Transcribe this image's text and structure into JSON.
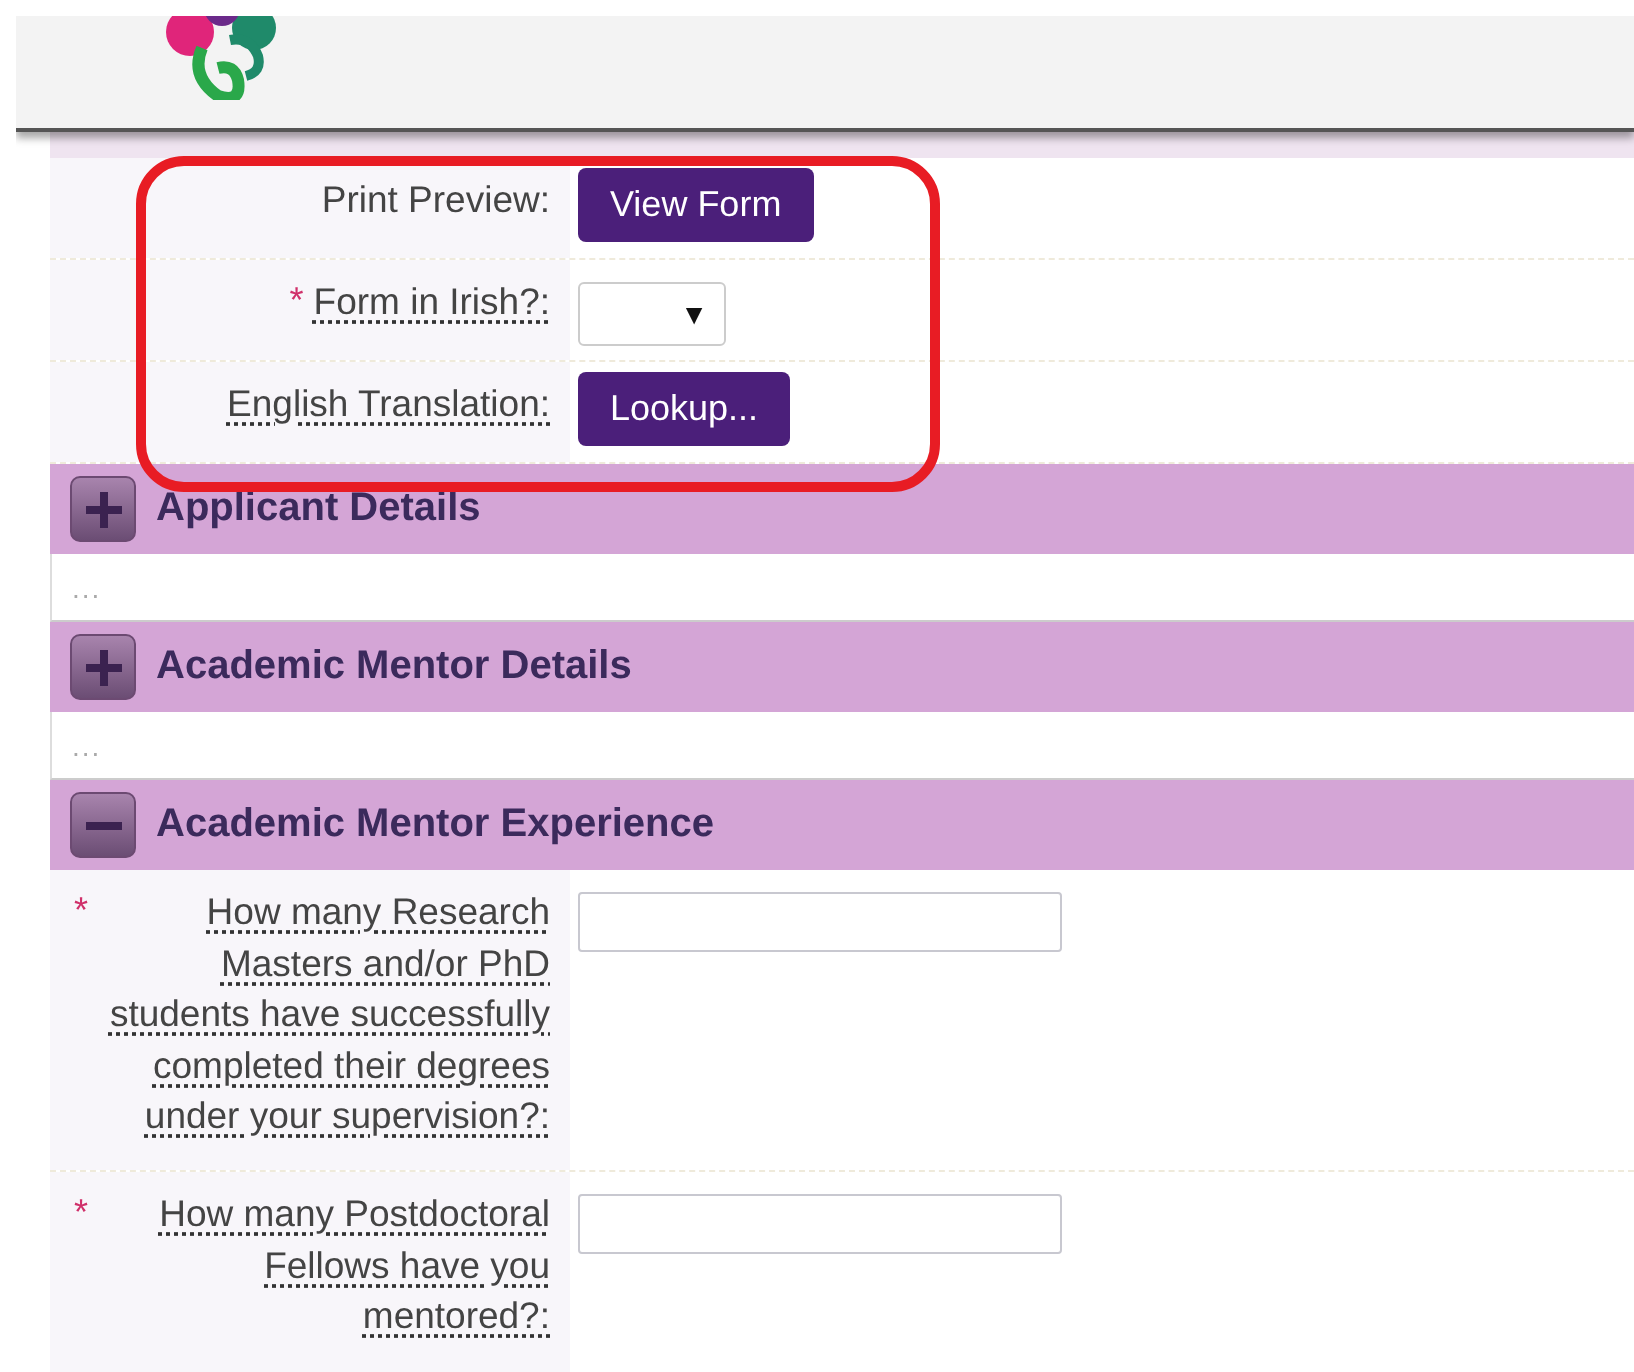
{
  "top_rows": [
    {
      "label": "Print Preview:",
      "required_mark": "",
      "help": false,
      "field": {
        "kind": "button",
        "text": "View Form"
      }
    },
    {
      "label": "Form in Irish?:",
      "required_mark": "*",
      "help": true,
      "field": {
        "kind": "select",
        "arrow": "▼"
      }
    },
    {
      "label": "English Translation:",
      "required_mark": "",
      "help": true,
      "field": {
        "kind": "button",
        "text": "Lookup..."
      }
    }
  ],
  "sections": [
    {
      "title": "Applicant Details",
      "expanded": false,
      "body": "..."
    },
    {
      "title": "Academic Mentor Details",
      "expanded": false,
      "body": "..."
    },
    {
      "title": "Academic Mentor Experience",
      "expanded": true,
      "questions": [
        {
          "label": "How many Research Masters and/or PhD students have successfully completed their degrees under your supervision?:",
          "required_mark": "*",
          "help": true,
          "field": {
            "kind": "text"
          }
        },
        {
          "label": "How many Postdoctoral Fellows have you mentored?:",
          "required_mark": "*",
          "help": true,
          "field": {
            "kind": "text"
          }
        }
      ]
    }
  ]
}
